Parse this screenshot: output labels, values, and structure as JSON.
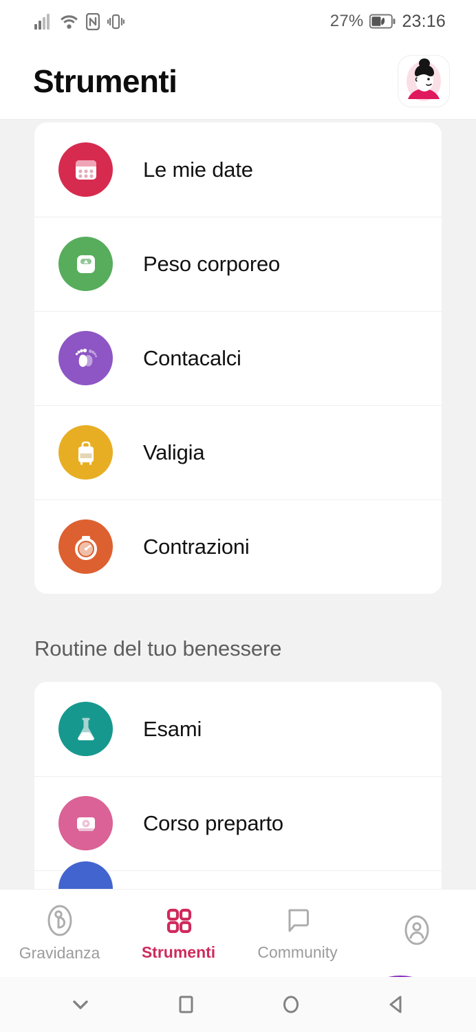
{
  "status_bar": {
    "icons": [
      "signal-bars-icon",
      "wifi-icon",
      "nfc-icon",
      "vibrate-icon"
    ],
    "battery_percent": "27%",
    "battery_icon": "battery-icon",
    "time": "23:16"
  },
  "header": {
    "title": "Strumenti",
    "avatar_name": "user-avatar"
  },
  "sections": [
    {
      "title": null,
      "items": [
        {
          "label": "Le mie date",
          "icon": "calendar-icon",
          "color": "#d62b4f"
        },
        {
          "label": "Peso corporeo",
          "icon": "scale-icon",
          "color": "#57ad5c"
        },
        {
          "label": "Contacalci",
          "icon": "footprints-icon",
          "color": "#8d56c4"
        },
        {
          "label": "Valigia",
          "icon": "suitcase-icon",
          "color": "#e8ae23"
        },
        {
          "label": "Contrazioni",
          "icon": "stopwatch-icon",
          "color": "#dd6030"
        }
      ]
    },
    {
      "title": "Routine del tuo benessere",
      "items": [
        {
          "label": "Esami",
          "icon": "flask-icon",
          "color": "#17988f"
        },
        {
          "label": "Corso preparto",
          "icon": "video-icon",
          "color": "#da6296"
        },
        {
          "label": "",
          "icon": "hidden-icon",
          "color": "#4264cf"
        }
      ]
    }
  ],
  "bottom_nav": {
    "items": [
      {
        "label": "Gravidanza",
        "icon": "pregnancy-icon",
        "active": false
      },
      {
        "label": "Strumenti",
        "icon": "grid-icon",
        "active": true
      },
      {
        "label": "Community",
        "icon": "chat-bubble-icon",
        "active": false
      },
      {
        "label": "",
        "icon": "profile-icon",
        "active": false
      }
    ],
    "active_color": "#cf2a5c",
    "inactive_color": "#9b9b9b"
  },
  "android_nav": {
    "buttons": [
      "chevron-down-icon",
      "recents-square-icon",
      "home-circle-icon",
      "back-triangle-icon"
    ]
  }
}
